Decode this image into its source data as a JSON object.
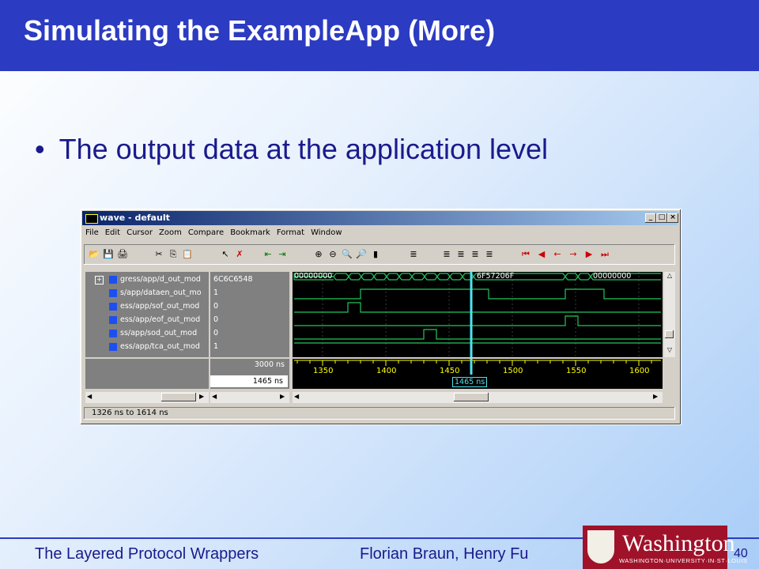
{
  "slide": {
    "title": "Simulating the ExampleApp (More)",
    "bullet": "The output data at the application level",
    "footer_left": "The Layered Protocol Wrappers",
    "footer_mid": "Florian Braun, Henry Fu",
    "page_number": "40",
    "logo_text": "Washington",
    "logo_subtext": "WASHINGTON·UNIVERSITY·IN·ST·LOUIS"
  },
  "window": {
    "title": "wave - default",
    "controls": [
      "_",
      "□",
      "×"
    ],
    "menu": [
      "File",
      "Edit",
      "Cursor",
      "Zoom",
      "Compare",
      "Bookmark",
      "Format",
      "Window"
    ],
    "toolbar_icons": [
      "open-icon",
      "save-icon",
      "print-icon",
      "cut-icon",
      "copy-icon",
      "paste-icon",
      "select-icon",
      "delete-icon",
      "zoom-in-icon",
      "zoom-out-icon",
      "zoom-full-icon",
      "zoom-range-icon",
      "find-icon",
      "add-cursor-icon",
      "remove-cursor-icon",
      "find-prev-edge-icon",
      "find-next-edge-icon"
    ],
    "signals": [
      {
        "name": "gress/app/d_out_mod",
        "value": "6C6C6548",
        "expandable": true
      },
      {
        "name": "s/app/dataen_out_mo",
        "value": "1"
      },
      {
        "name": "ess/app/sof_out_mod",
        "value": "0"
      },
      {
        "name": "ess/app/eof_out_mod",
        "value": "0"
      },
      {
        "name": "ss/app/sod_out_mod",
        "value": "0"
      },
      {
        "name": "ess/app/tca_out_mod",
        "value": "1"
      }
    ],
    "bus_labels": [
      "00000000",
      "6F57206F",
      "00000000"
    ],
    "total_time": "3000 ns",
    "cursor_time": "1465 ns",
    "cursor_flag": "1465 ns",
    "time_ticks": [
      "1350",
      "1400",
      "1450",
      "1500",
      "1550",
      "1600"
    ],
    "status": "1326 ns to 1614 ns",
    "colors": {
      "trace": "#22c55e",
      "cursor": "#4ee3f0",
      "ticks": "#ffff00"
    }
  }
}
